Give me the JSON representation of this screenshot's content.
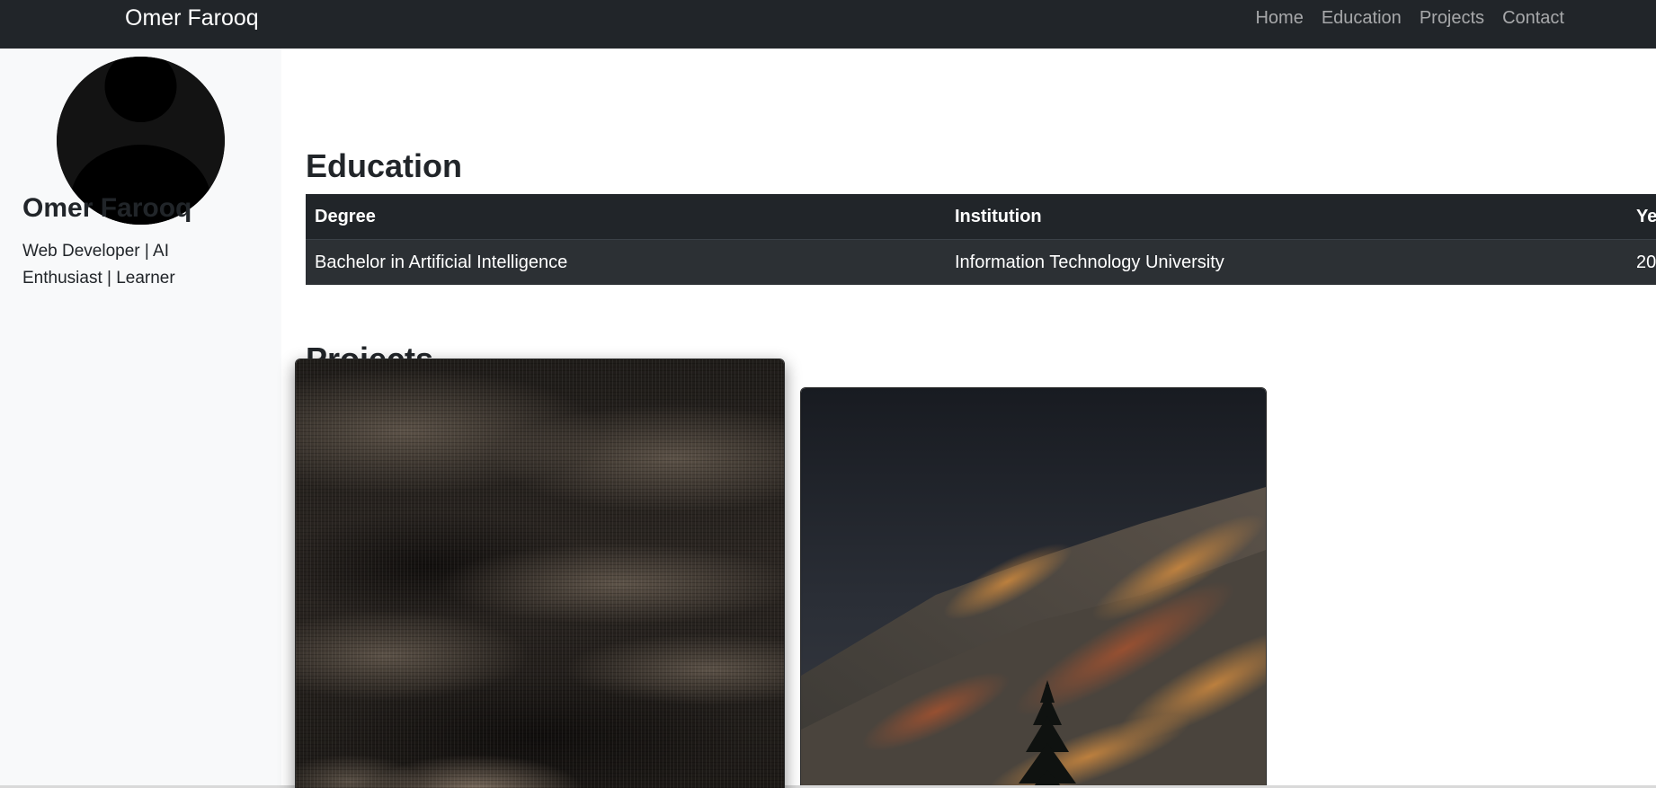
{
  "navbar": {
    "brand": "Omer Farooq",
    "links": [
      "Home",
      "Education",
      "Projects",
      "Contact"
    ]
  },
  "sidebar": {
    "name": "Omer Farooq",
    "tagline": "Web Developer | AI Enthusiast | Learner",
    "avatar_icon": "user-silhouette-icon"
  },
  "education": {
    "title": "Education",
    "headers": [
      "Degree",
      "Institution",
      "Ye"
    ],
    "rows": [
      [
        "Bachelor in Artificial Intelligence",
        "Information Technology University",
        "20"
      ]
    ]
  },
  "projects": {
    "title": "Projects"
  },
  "colors": {
    "navbar_bg": "#212529",
    "sidebar_bg": "#f8f9fa",
    "table_bg": "#212529",
    "text_dark": "#212529"
  }
}
